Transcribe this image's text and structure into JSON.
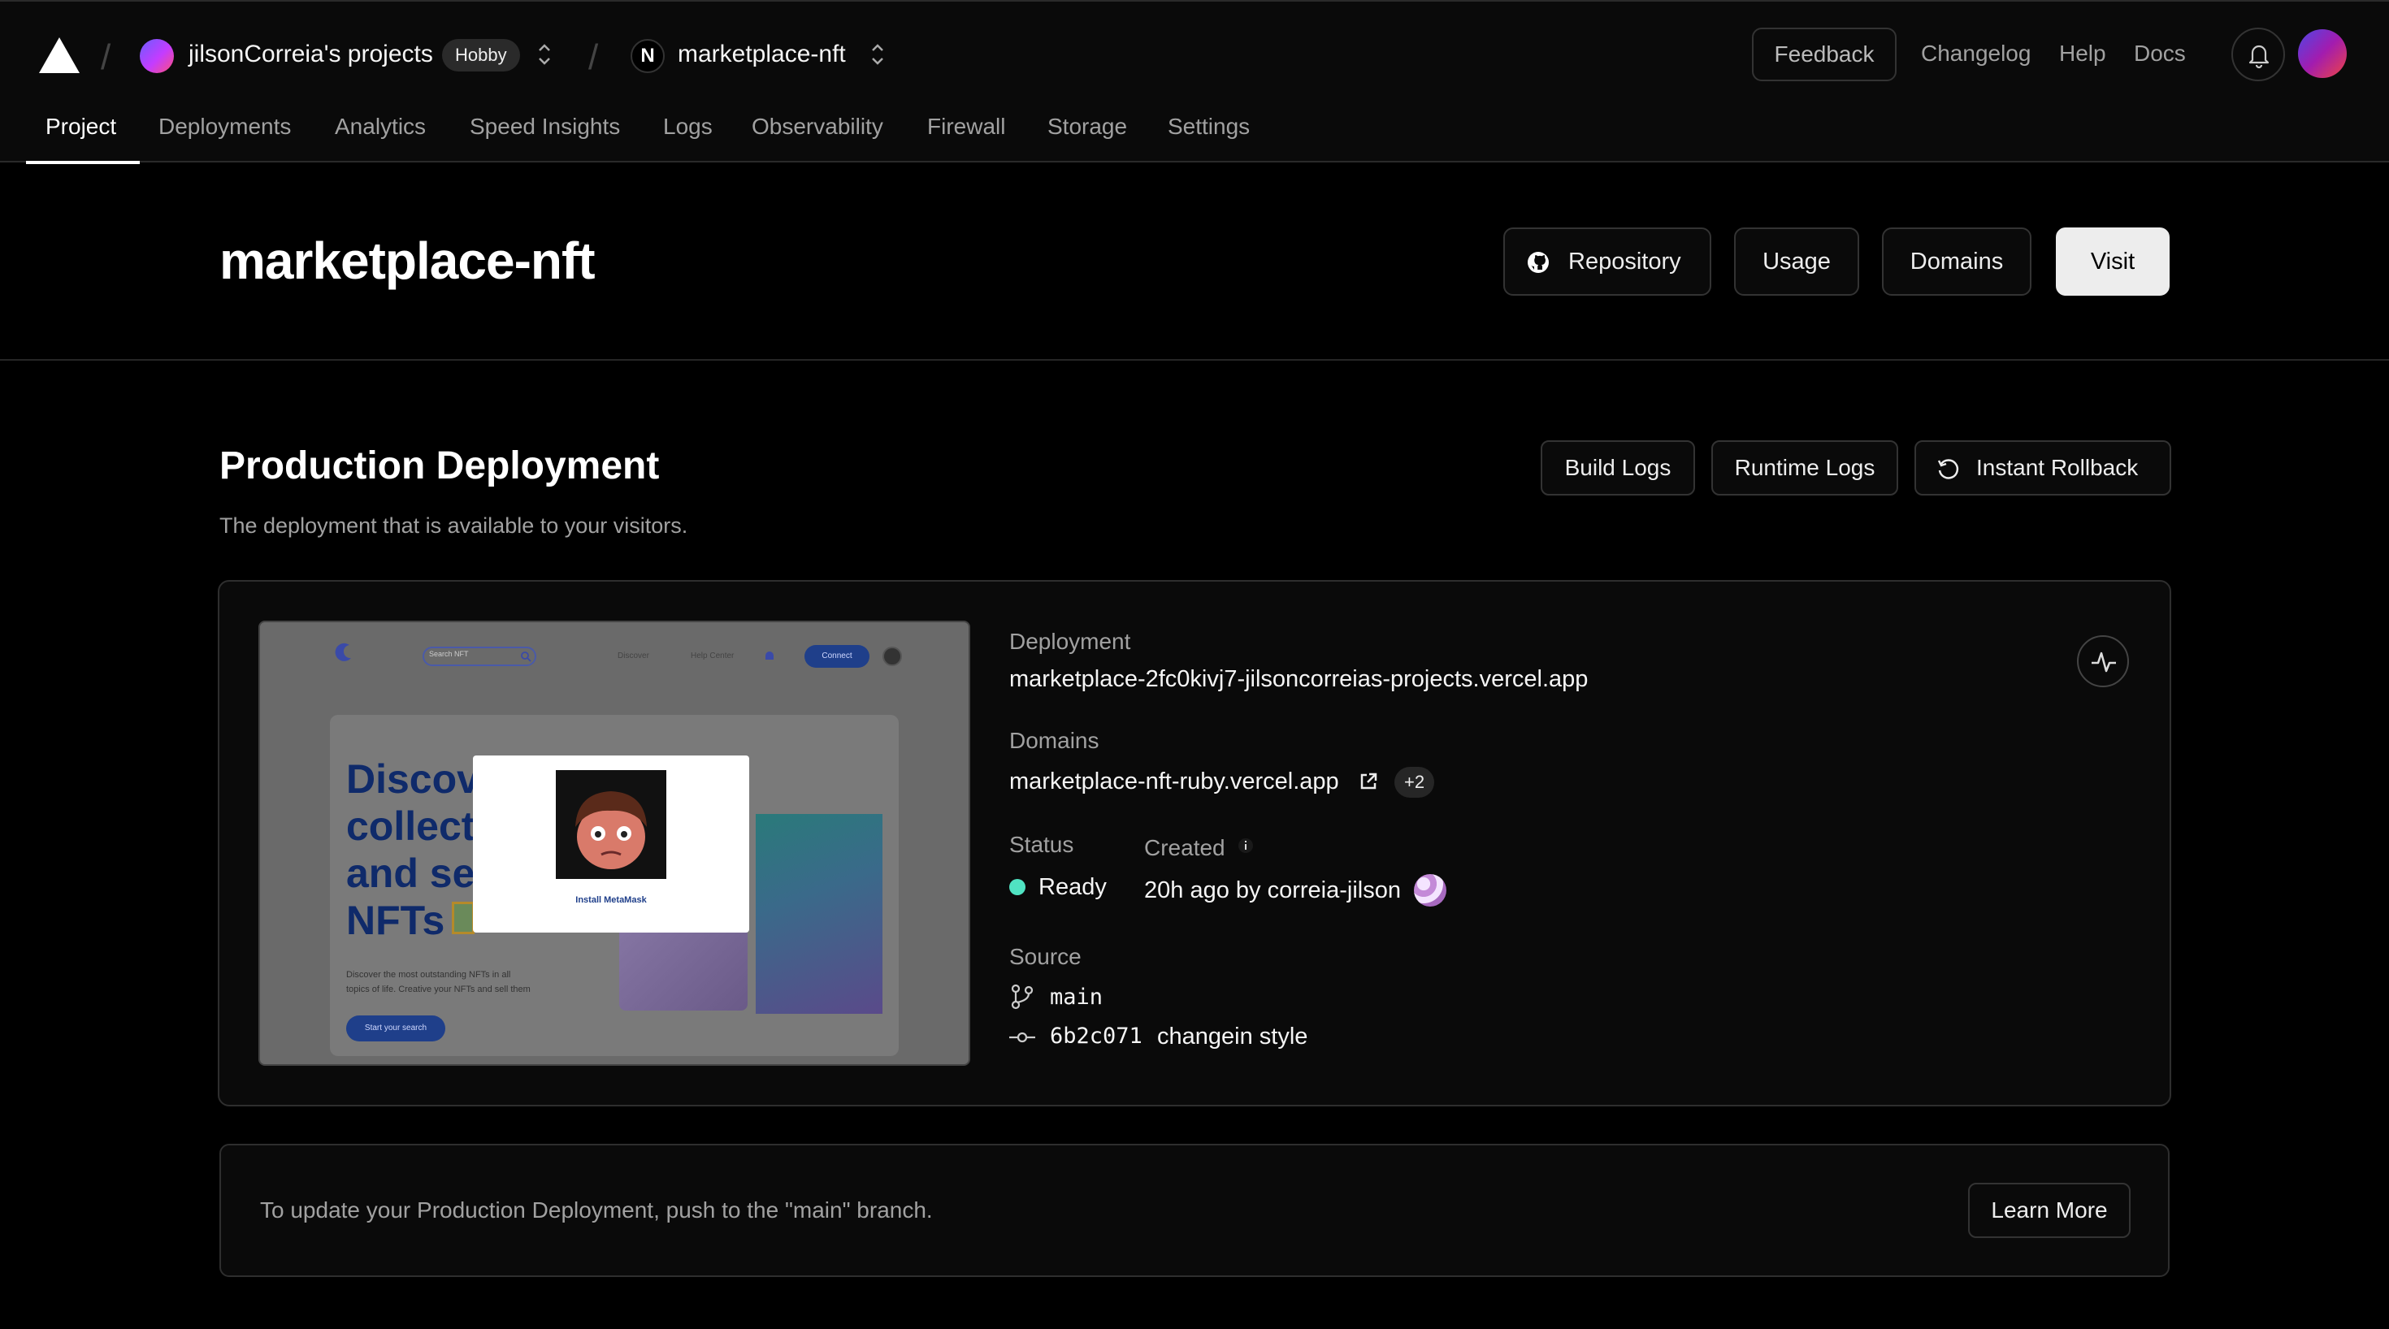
{
  "header": {
    "team_name": "jilsonCorreia's projects",
    "plan_badge": "Hobby",
    "project_name": "marketplace-nft",
    "project_icon_letter": "N",
    "feedback_label": "Feedback",
    "links": [
      "Changelog",
      "Help",
      "Docs"
    ]
  },
  "tabs": [
    "Project",
    "Deployments",
    "Analytics",
    "Speed Insights",
    "Logs",
    "Observability",
    "Firewall",
    "Storage",
    "Settings"
  ],
  "active_tab": "Project",
  "page": {
    "title": "marketplace-nft",
    "buttons": {
      "repository": "Repository",
      "usage": "Usage",
      "domains": "Domains",
      "visit": "Visit"
    }
  },
  "production": {
    "title": "Production Deployment",
    "subtitle": "The deployment that is available to your visitors.",
    "buttons": {
      "build_logs": "Build Logs",
      "runtime_logs": "Runtime Logs",
      "rollback": "Instant Rollback"
    },
    "deployment_label": "Deployment",
    "deployment_url": "marketplace-2fc0kivj7-jilsoncorreias-projects.vercel.app",
    "domains_label": "Domains",
    "domain": "marketplace-nft-ruby.vercel.app",
    "domains_more": "+2",
    "status_label": "Status",
    "status_value": "Ready",
    "status_color": "#50e3c2",
    "created_label": "Created",
    "created_value": "20h ago by correia-jilson",
    "source_label": "Source",
    "branch": "main",
    "commit_hash": "6b2c071",
    "commit_message": "changein style"
  },
  "preview": {
    "search_placeholder": "Search NFT",
    "nav_links": [
      "Discover",
      "Help Center"
    ],
    "connect_label": "Connect",
    "hero_lines": [
      "Discov",
      "collect",
      "and se",
      "NFTs"
    ],
    "hero_sub_1": "Discover the most outstanding NFTs in all",
    "hero_sub_2": "topics of life. Creative your NFTs and sell them",
    "hero_btn": "Start your search",
    "modal_label": "Install MetaMask"
  },
  "info_bar": {
    "text": "To update your Production Deployment, push to the \"main\" branch.",
    "learn_more": "Learn More"
  }
}
